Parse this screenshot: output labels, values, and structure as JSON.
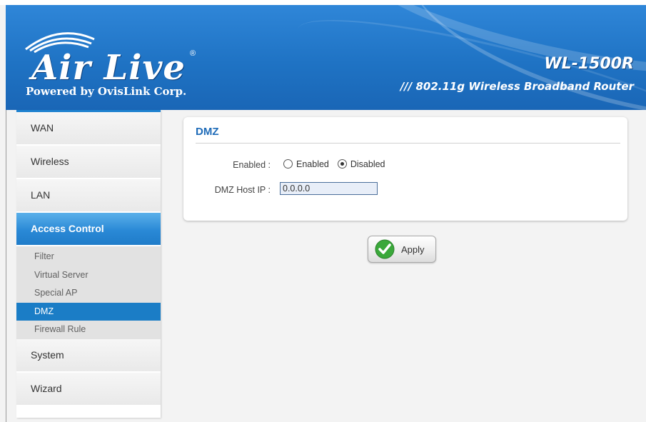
{
  "header": {
    "brand": "Air Live",
    "registered": "®",
    "tagline": "Powered by OvisLink Corp.",
    "model": "WL-1500R",
    "model_desc": "/// 802.11g Wireless Broadband Router"
  },
  "sidebar": {
    "items_top": [
      {
        "label": "WAN"
      },
      {
        "label": "Wireless"
      },
      {
        "label": "LAN"
      },
      {
        "label": "Access Control",
        "active": true
      }
    ],
    "subitems": [
      {
        "label": "Filter"
      },
      {
        "label": "Virtual Server"
      },
      {
        "label": "Special AP"
      },
      {
        "label": "DMZ",
        "selected": true
      },
      {
        "label": "Firewall Rule"
      }
    ],
    "items_bottom": [
      {
        "label": "System"
      },
      {
        "label": "Wizard"
      }
    ]
  },
  "panel": {
    "title": "DMZ",
    "enabled_label": "Enabled :",
    "radio_enabled": "Enabled",
    "radio_disabled": "Disabled",
    "selected": "Disabled",
    "host_label": "DMZ Host IP :",
    "host_value": "0.0.0.0"
  },
  "apply_label": "Apply",
  "colors": {
    "header_blue": "#1f73c4",
    "active_nav": "#2a89d6",
    "selected_sub": "#1b7dc6",
    "title_blue": "#1e6bb8",
    "apply_check": "#3aa83a"
  }
}
